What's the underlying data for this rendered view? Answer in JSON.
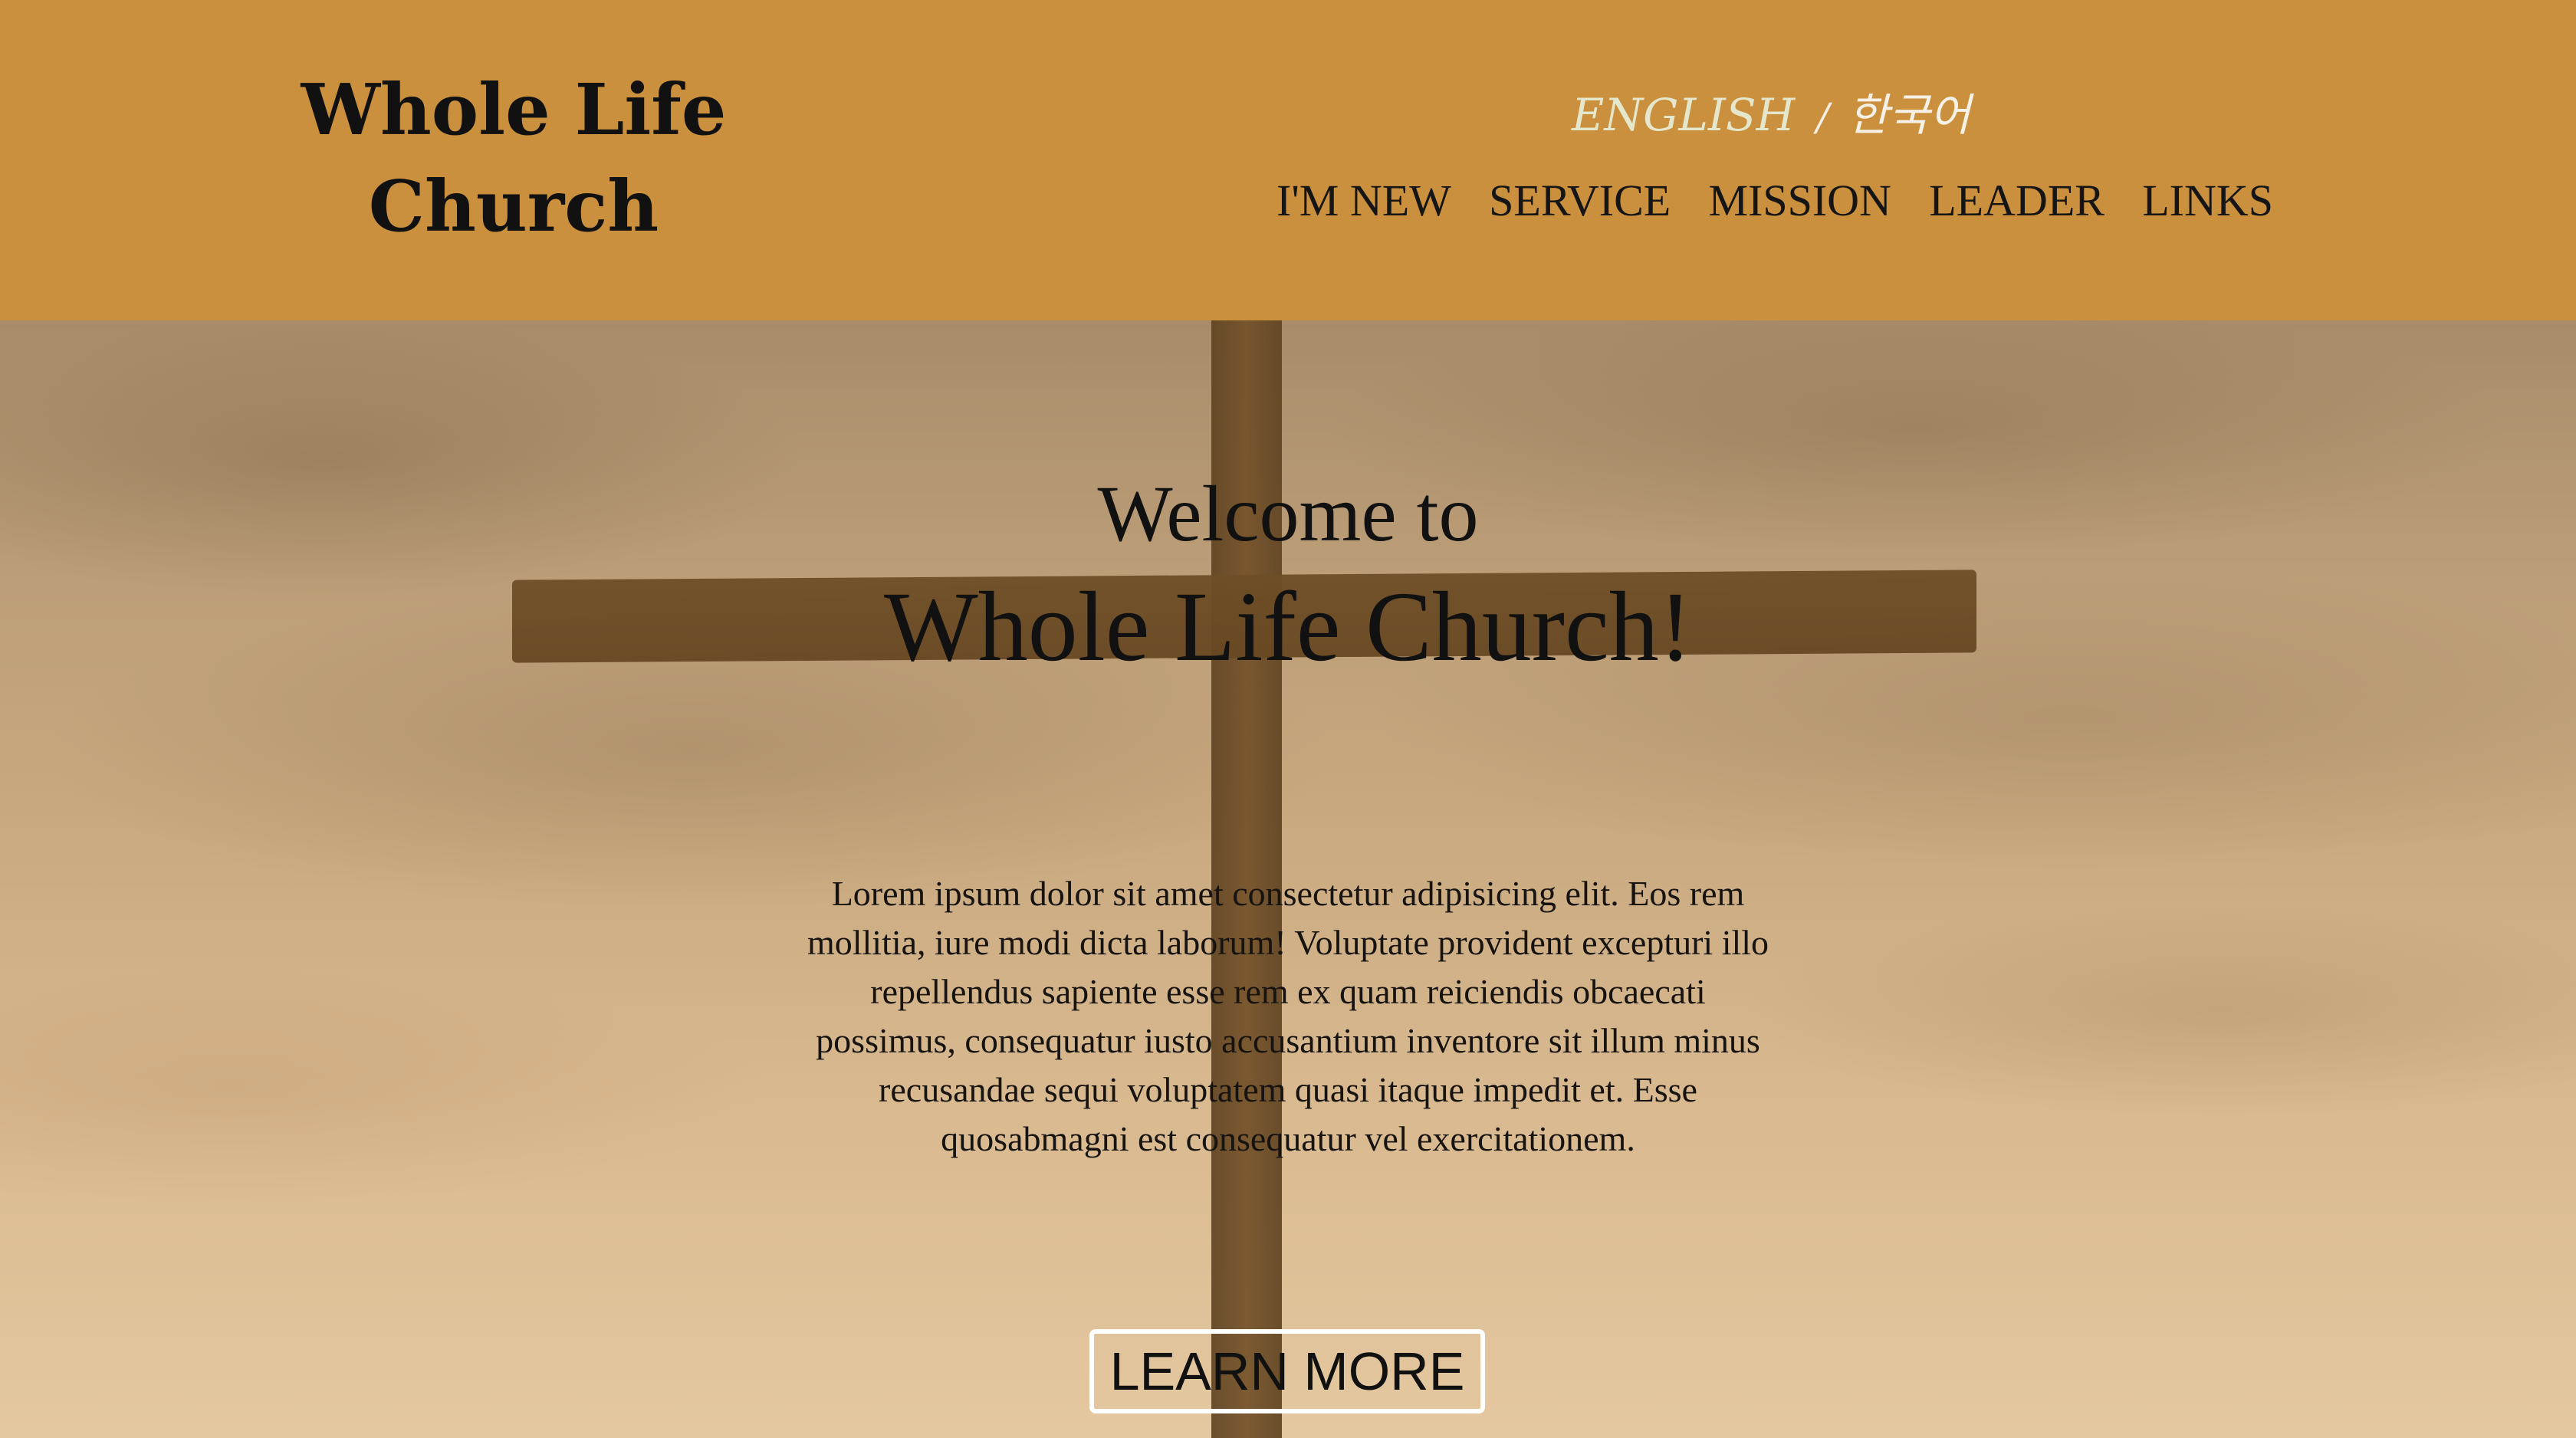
{
  "header": {
    "logo_line1": "Whole Life",
    "logo_line2": "Church",
    "language": {
      "english": "ENGLISH",
      "separator": "/",
      "korean": "한국어"
    },
    "nav": [
      {
        "label": "I'M NEW"
      },
      {
        "label": "SERVICE"
      },
      {
        "label": "MISSION"
      },
      {
        "label": "LEADER"
      },
      {
        "label": "LINKS"
      }
    ]
  },
  "hero": {
    "welcome_line1": "Welcome to",
    "welcome_line2": "Whole Life Church!",
    "intro_text": "Lorem ipsum dolor sit amet consectetur adipisicing elit. Eos rem mollitia, iure modi dicta laborum! Voluptate provident excepturi illo repellendus sapiente esse rem ex quam reiciendis obcaecati possimus, consequatur iusto accusantium inventore sit illum minus recusandae sequi voluptatem quasi itaque impedit et. Esse quosabmagni est consequatur vel exercitationem.",
    "cta_label": "LEARN MORE",
    "background_image": "cross-against-cloudy-sky"
  },
  "colors": {
    "header_bg": "#ca903d",
    "text": "#111111",
    "english_link": "#e4e7cc",
    "korean_link": "#f6f1e6",
    "button_border": "#ffffff"
  }
}
